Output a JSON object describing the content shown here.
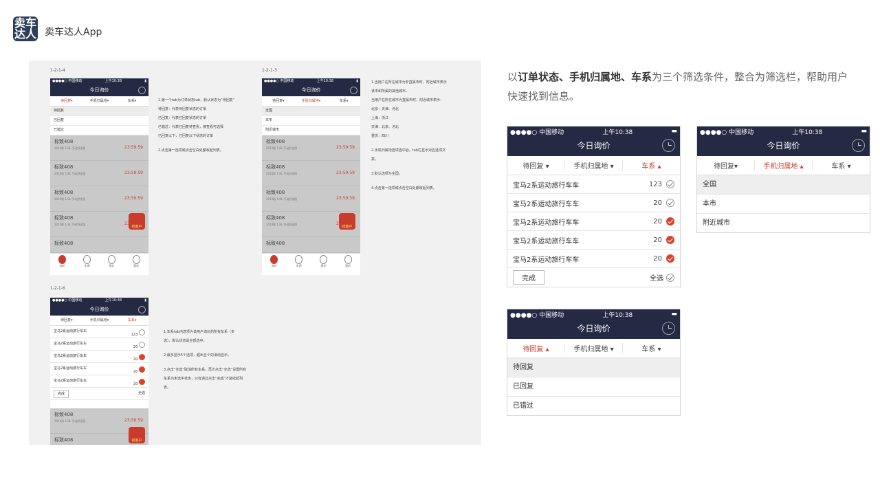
{
  "header": {
    "logo_text": "卖车达人",
    "logo_line1": "卖车",
    "logo_line2": "达人",
    "app_name": "卖车达人App"
  },
  "board": {
    "labels": [
      "1-2-1-4",
      "1-2-1-3",
      "1-2-1-6"
    ],
    "phone_title": "今日询价",
    "status_left": "●●●●○ 中国移动 ",
    "status_time": "上午10:38",
    "filters": [
      "待回复▾",
      "手机归属地▾",
      "车系▾"
    ],
    "ph1_opts": [
      "待回复",
      "已回复",
      "已错过"
    ],
    "ph2_opts": [
      "全国",
      "本市",
      "附近城市"
    ],
    "card_title": "标致408",
    "card_sub": "2014款 1.8L 手动舒适版",
    "card_time": "23:59:59",
    "tabs": [
      "询价",
      "车源",
      "报价",
      "我的"
    ],
    "badge": "找客户",
    "note1": [
      "1.第一个tab为订单状态tab，默认状态为“待回复”",
      "待回复：代表待回复状态的订单",
      "已回复：代表已回复状态的订单",
      "已错过：代表已回复待查看，被查看可选择",
      "已回复以下，已回复以下状态的订单",
      "",
      "2.点击第一选项或点击空白处都收起列表。"
    ],
    "note2": [
      "1.当用户在所在城市为非直属市时，附近城市表示",
      "该市和所属的其他城市。",
      "当用户在所在城市为直属市时，附近城市表示：",
      "北京：天津、河北",
      "上海：浙江",
      "天津：北京、河北",
      "重庆：四川",
      "",
      "2.手机归属地选项选中后，tab栏显示对应选项文",
      "案。",
      "",
      "3.默认选项为全国。",
      "",
      "4.点击第一选项或点击空白处都收起列表。"
    ],
    "note3": [
      "1.车系tab内选项为该用户询价的所有车系（多",
      "选），默认状态是全部选中。",
      "",
      "2.最多显示5个选项，超出五个的滑动显示。",
      "",
      "3.点击“全选”取消所有车系，再次点击“全选”设置所有",
      "车系为未选中状态，只有通过点击“完成”才能收起列",
      "表。"
    ],
    "ph3_rows": [
      {
        "name": "宝马2系运动旅行车车",
        "count": "123"
      },
      {
        "name": "宝马2系运动旅行车车",
        "count": "20"
      },
      {
        "name": "宝马2系运动旅行车车",
        "count": "20"
      },
      {
        "name": "宝马2系运动旅行车车",
        "count": "20"
      },
      {
        "name": "宝马2系运动旅行车车",
        "count": "20"
      }
    ],
    "done": "完成",
    "select_all": "全选"
  },
  "description": {
    "prefix": "以",
    "bold": "订单状态、手机归属地、车系",
    "suffix": "为三个筛选条件，整合为筛选栏，帮助用户快速找到信息。"
  },
  "phone_a": {
    "status_left": "●●●●○ 中国移动 ",
    "status_time": "上午10:38",
    "title": "今日询价",
    "filters": [
      "待回复 ▾",
      "手机归属地 ▾",
      "车系 ▴"
    ],
    "rows": [
      {
        "name": "宝马2系运动旅行车车",
        "count": "123",
        "checked": false
      },
      {
        "name": "宝马2系运动旅行车车",
        "count": "20",
        "checked": false
      },
      {
        "name": "宝马2系运动旅行车车",
        "count": "20",
        "checked": true
      },
      {
        "name": "宝马2系运动旅行车车",
        "count": "20",
        "checked": true
      },
      {
        "name": "宝马2系运动旅行车车",
        "count": "20",
        "checked": true
      }
    ],
    "done_label": "完成",
    "select_all_label": "全选"
  },
  "phone_b": {
    "status_left": "●●●●○ 中国移动 ",
    "status_time": "上午10:38",
    "title": "今日询价",
    "filters": [
      "待回复▾",
      "手机归属地 ▴",
      "车系 ▾"
    ],
    "options": [
      "全国",
      "本市",
      "附近城市"
    ]
  },
  "phone_c": {
    "status_left": "●●●●○ 中国移动 ",
    "status_time": "上午10:38",
    "title": "今日询价",
    "filters": [
      "待回复 ▴",
      "手机归属地 ▾",
      "车系 ▾"
    ],
    "options": [
      "待回复",
      "已回复",
      "已错过"
    ]
  },
  "colors": {
    "nav": "#252a44",
    "accent": "#c93b2a",
    "check": "#d9432c",
    "logo": "#2d3e5a"
  }
}
